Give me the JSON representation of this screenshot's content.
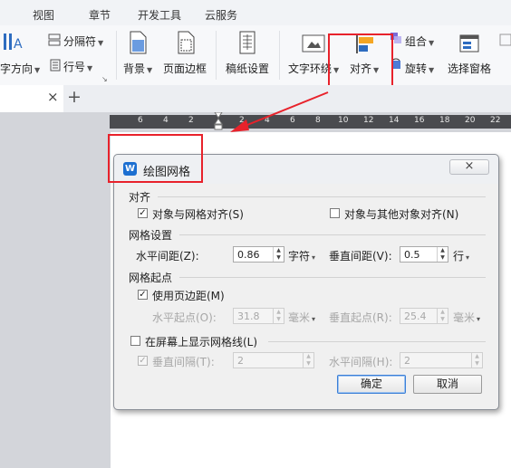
{
  "menubar": {
    "items": [
      "视图",
      "章节",
      "开发工具",
      "云服务"
    ]
  },
  "ribbon": {
    "text_direction": "字方向",
    "separator": "分隔符",
    "line_number": "行号",
    "background": "背景",
    "page_border": "页面边框",
    "manuscript": "稿纸设置",
    "text_wrap": "文字环绕",
    "align": "对齐",
    "group": "组合",
    "rotate": "旋转",
    "select_pane": "选择窗格"
  },
  "tabbar": {
    "close": "×",
    "add": "+"
  },
  "ruler": {
    "ticks": [
      "6",
      "4",
      "2",
      "2",
      "4",
      "6",
      "8",
      "10",
      "12",
      "14",
      "16",
      "18",
      "20",
      "22"
    ]
  },
  "dialog": {
    "title": "绘图网格",
    "close": "×",
    "align_group": "对齐",
    "snap_grid": "对象与网格对齐(S)",
    "snap_objects": "对象与其他对象对齐(N)",
    "grid_group": "网格设置",
    "h_spacing_label": "水平间距(Z):",
    "h_spacing_value": "0.86",
    "h_spacing_unit": "字符",
    "v_spacing_label": "垂直间距(V):",
    "v_spacing_value": "0.5",
    "v_spacing_unit": "行",
    "origin_group": "网格起点",
    "use_margin": "使用页边距(M)",
    "h_origin_label": "水平起点(O):",
    "h_origin_value": "31.8",
    "h_origin_unit": "毫米",
    "v_origin_label": "垂直起点(R):",
    "v_origin_value": "25.4",
    "v_origin_unit": "毫米",
    "show_grid": "在屏幕上显示网格线(L)",
    "v_interval_label": "垂直间隔(T):",
    "v_interval_value": "2",
    "h_interval_label": "水平间隔(H):",
    "h_interval_value": "2",
    "ok": "确定",
    "cancel": "取消"
  },
  "colors": {
    "highlight": "#e8222b",
    "accent": "#1c6fd1"
  }
}
